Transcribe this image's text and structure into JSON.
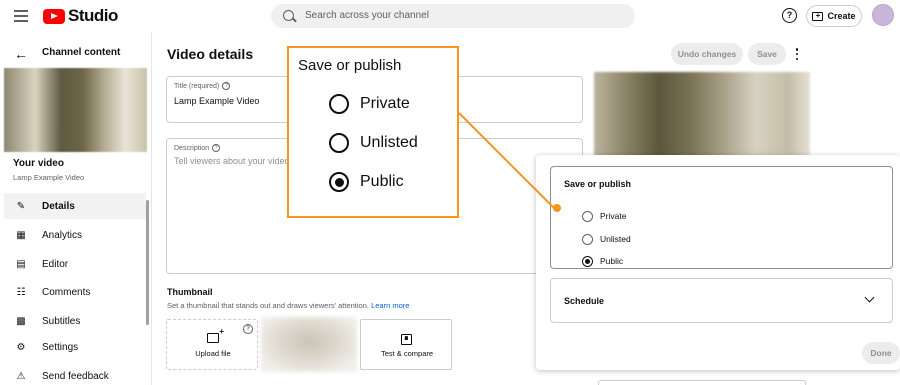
{
  "app": {
    "logo_text": "Studio",
    "search_placeholder": "Search across your channel",
    "create_label": "Create",
    "help_glyph": "?"
  },
  "sidebar": {
    "back_label": "Channel content",
    "your_video_label": "Your video",
    "video_name": "Lamp Example Video",
    "items": [
      {
        "label": "Details",
        "icon": "pencil-icon",
        "active": true
      },
      {
        "label": "Analytics",
        "icon": "analytics-icon",
        "active": false
      },
      {
        "label": "Editor",
        "icon": "editor-icon",
        "active": false
      },
      {
        "label": "Comments",
        "icon": "comments-icon",
        "active": false
      },
      {
        "label": "Subtitles",
        "icon": "subtitles-icon",
        "active": false
      },
      {
        "label": "Settings",
        "icon": "gear-icon",
        "active": false
      },
      {
        "label": "Send feedback",
        "icon": "feedback-icon",
        "active": false
      }
    ]
  },
  "main": {
    "page_title": "Video details",
    "undo_label": "Undo changes",
    "save_label": "Save",
    "title_field": {
      "label": "Title (required)",
      "value": "Lamp Example Video"
    },
    "description_field": {
      "label": "Description",
      "placeholder": "Tell viewers about your video"
    },
    "thumbnail": {
      "heading": "Thumbnail",
      "subtitle": "Set a thumbnail that stands out and draws viewers' attention.",
      "learn_more": "Learn more",
      "upload_label": "Upload file",
      "test_label": "Test & compare"
    }
  },
  "visibility_panel": {
    "title": "Save or publish",
    "options": [
      "Private",
      "Unlisted",
      "Public"
    ],
    "selected": "Public",
    "schedule_label": "Schedule",
    "done_label": "Done"
  },
  "callout": {
    "title": "Save or publish",
    "options": [
      "Private",
      "Unlisted",
      "Public"
    ],
    "selected": "Public",
    "color": "#f7931e"
  }
}
